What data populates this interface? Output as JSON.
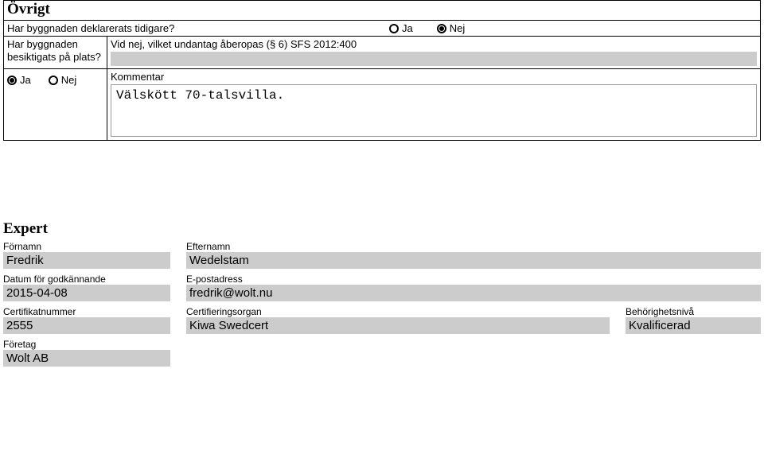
{
  "section1": {
    "heading": "Övrigt",
    "q1": {
      "text": "Har byggnaden deklarerats tidigare?",
      "yes": "Ja",
      "no": "Nej",
      "selected": "no"
    },
    "q2": {
      "leftText": "Har byggnaden besiktigats på plats?",
      "rightLabel": "Vid nej, vilket undantag åberopas (§ 6) SFS 2012:400",
      "value": ""
    },
    "row3": {
      "yes": "Ja",
      "no": "Nej",
      "selected": "yes",
      "commentLabel": "Kommentar",
      "commentValue": "Välskött 70-talsvilla."
    }
  },
  "expert": {
    "heading": "Expert",
    "fornamnLabel": "Förnamn",
    "fornamnValue": "Fredrik",
    "efternamnLabel": "Efternamn",
    "efternamnValue": "Wedelstam",
    "datumLabel": "Datum för godkännande",
    "datumValue": "2015-04-08",
    "epostLabel": "E-postadress",
    "epostValue": "fredrik@wolt.nu",
    "certnumLabel": "Certifikatnummer",
    "certnumValue": "2555",
    "certorgLabel": "Certifieringsorgan",
    "certorgValue": "Kiwa Swedcert",
    "behorLabel": "Behörighetsnivå",
    "behorValue": "Kvalificerad",
    "foretagLabel": "Företag",
    "foretagValue": "Wolt AB"
  }
}
